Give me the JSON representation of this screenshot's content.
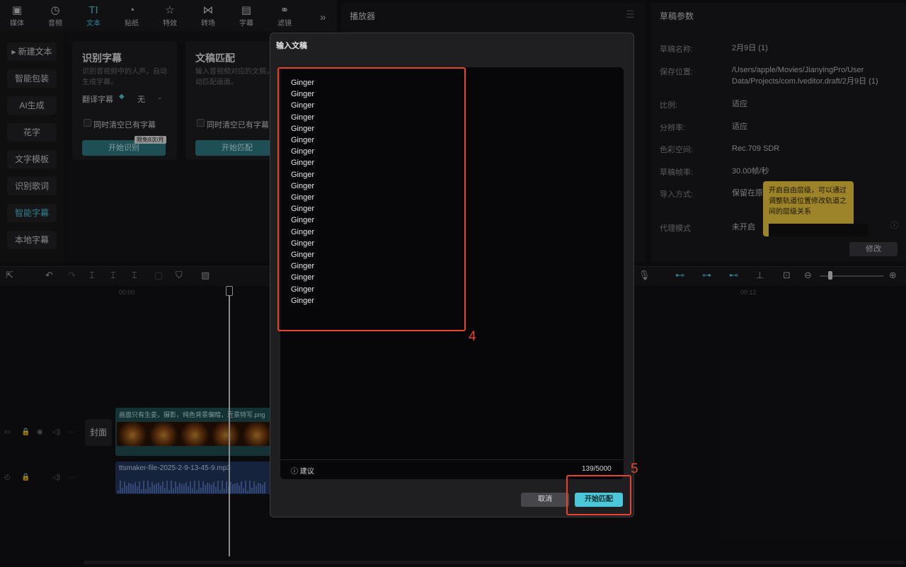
{
  "toolbar": {
    "tabs": [
      {
        "label": "媒体",
        "icon": "media-icon"
      },
      {
        "label": "音频",
        "icon": "audio-icon"
      },
      {
        "label": "文本",
        "icon": "text-icon",
        "active": true
      },
      {
        "label": "贴纸",
        "icon": "sticker-icon"
      },
      {
        "label": "特效",
        "icon": "effects-icon"
      },
      {
        "label": "转场",
        "icon": "transition-icon"
      },
      {
        "label": "字幕",
        "icon": "subtitle-icon"
      },
      {
        "label": "滤镜",
        "icon": "filter-icon"
      }
    ]
  },
  "sidebar": {
    "items": [
      {
        "label": "▸ 新建文本"
      },
      {
        "label": "智能包装"
      },
      {
        "label": "AI生成"
      },
      {
        "label": "花字"
      },
      {
        "label": "文字模板"
      },
      {
        "label": "识别歌词"
      },
      {
        "label": "智能字幕",
        "active": true
      },
      {
        "label": "本地字幕"
      }
    ]
  },
  "cards": {
    "recognize": {
      "title": "识别字幕",
      "desc": "识别音视频中的人声，自动生成字幕。",
      "translate_label": "翻译字幕",
      "translate_value": "无",
      "clear_label": "同时清空已有字幕",
      "badge": "限免8次/月",
      "button": "开始识别"
    },
    "match": {
      "title": "文稿匹配",
      "desc": "输入音视频对应的文稿，自动匹配画面。",
      "clear_label": "同时清空已有字幕",
      "button": "开始匹配"
    }
  },
  "player": {
    "title": "播放器"
  },
  "params": {
    "title": "草稿参数",
    "rows": [
      {
        "label": "草稿名称:",
        "value": "2月9日 (1)"
      },
      {
        "label": "保存位置:",
        "value": "/Users/apple/Movies/JianyingPro/User Data/Projects/com.lveditor.draft/2月9日 (1)"
      },
      {
        "label": "比例:",
        "value": "适应"
      },
      {
        "label": "分辨率:",
        "value": "适应"
      },
      {
        "label": "色彩空间:",
        "value": "Rec.709 SDR"
      },
      {
        "label": "草稿帧率:",
        "value": "30.00帧/秒"
      },
      {
        "label": "导入方式:",
        "value": "保留在原"
      },
      {
        "label": "代理模式",
        "value": "未开启"
      }
    ],
    "modify_button": "修改",
    "tooltip": "开启自由层级，可以通过调整轨道位置修改轨道之间的层级关系"
  },
  "timeline": {
    "ruler": [
      "00:00",
      "00:12"
    ],
    "cover_label": "封面",
    "video_clip_label": "画面只有生姜，摄影，纯色背景偏暗，近景特写.png",
    "audio_clip_label": "ttsmaker-file-2025-2-9-13-45-9.mp3"
  },
  "dialog": {
    "title": "输入文稿",
    "lines": [
      "Ginger",
      "Ginger",
      "Ginger",
      "Ginger",
      "Ginger",
      "Ginger",
      "Ginger",
      "Ginger",
      "Ginger",
      "Ginger",
      "Ginger",
      "Ginger",
      "Ginger",
      "Ginger",
      "Ginger",
      "Ginger",
      "Ginger",
      "Ginger",
      "Ginger",
      "Ginger"
    ],
    "suggest_label": "建议",
    "char_count": "139/5000",
    "cancel_button": "取消",
    "start_button": "开始匹配"
  },
  "annotations": {
    "box1_label": "4",
    "box2_label": "5"
  },
  "colors": {
    "accent": "#4cc7d9",
    "annotation": "#e8432d",
    "tooltip": "#f3cb3e"
  }
}
